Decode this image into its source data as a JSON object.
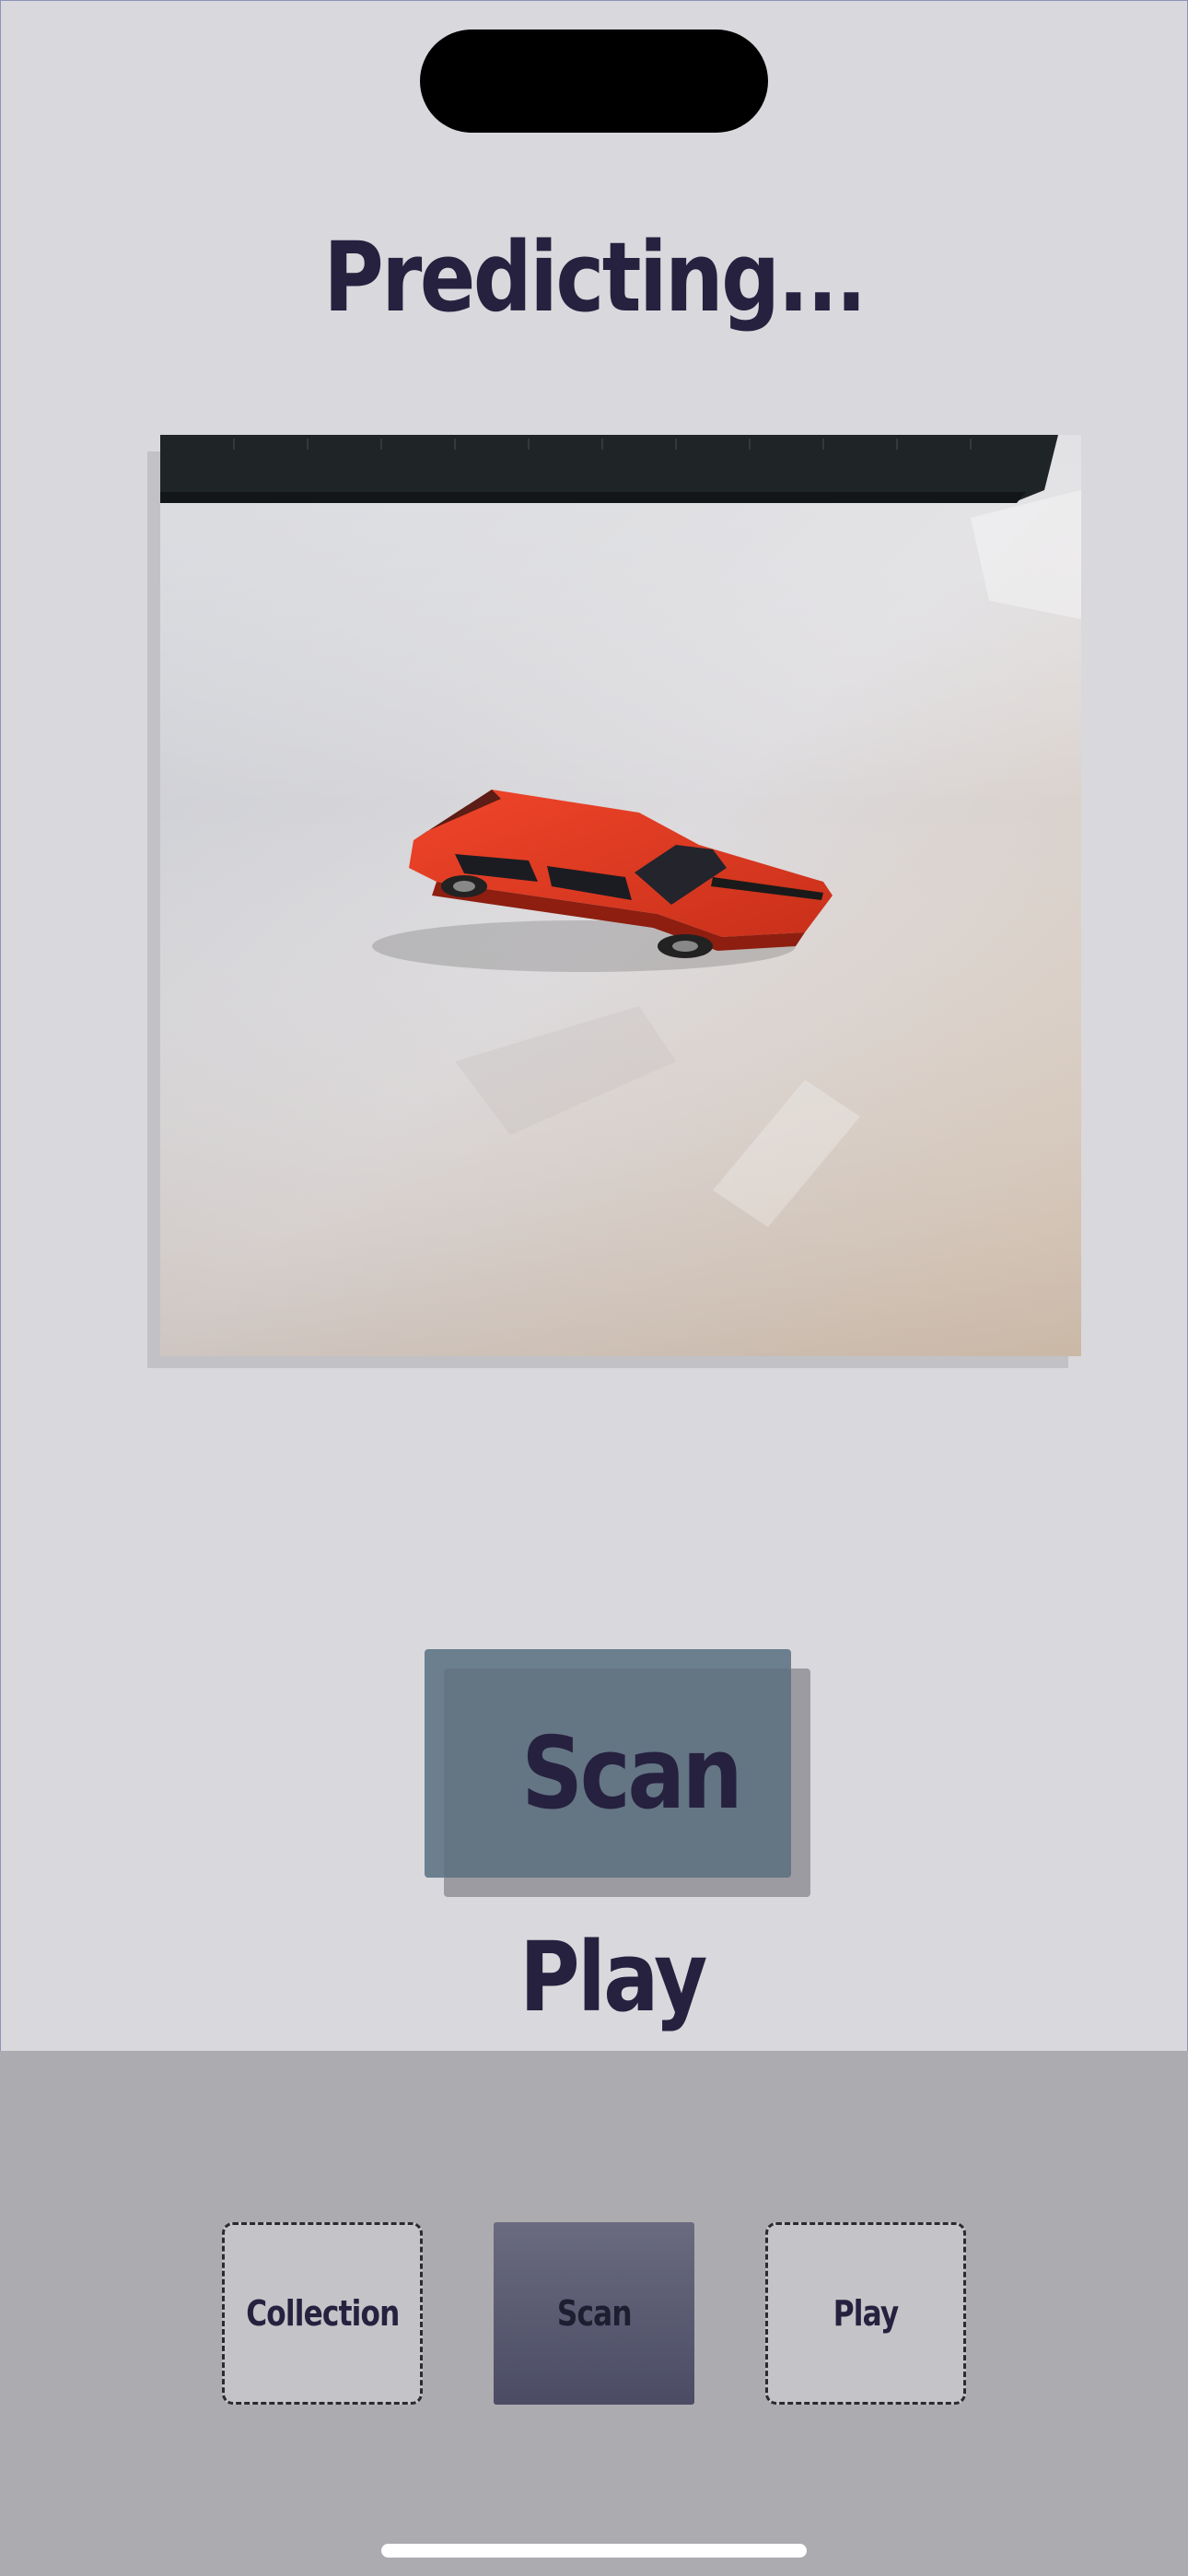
{
  "screen": {
    "title": "Predicting..."
  },
  "photo": {
    "subject": "red toy car on white surface"
  },
  "scan_button": {
    "label": "Scan"
  },
  "play_link": {
    "label": "Play"
  },
  "tabbar": {
    "tabs": [
      {
        "label": "Collection",
        "active": false
      },
      {
        "label": "Scan",
        "active": true
      },
      {
        "label": "Play",
        "active": false
      }
    ]
  },
  "colors": {
    "background": "#d9d8dc",
    "text": "#26213f",
    "scan_button": "#6b7f8e",
    "tabbar": "#acabaf",
    "active_tab": "#5b5c73"
  }
}
